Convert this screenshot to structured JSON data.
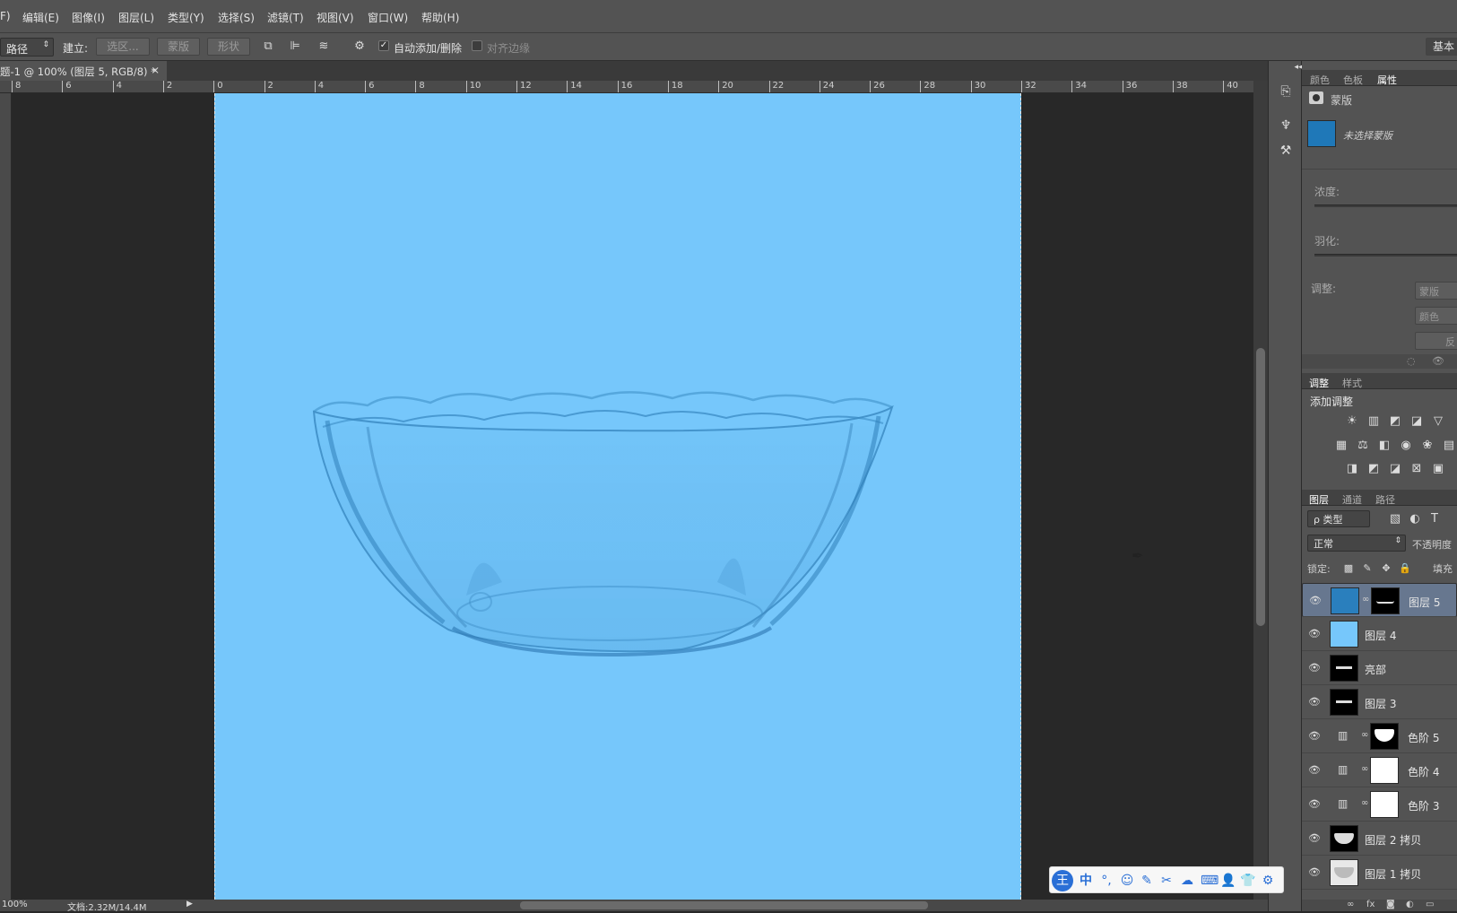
{
  "menu": [
    "F)",
    "编辑(E)",
    "图像(I)",
    "图层(L)",
    "类型(Y)",
    "选择(S)",
    "滤镜(T)",
    "视图(V)",
    "窗口(W)",
    "帮助(H)"
  ],
  "options_bar": {
    "mode_select": "路径",
    "create_label": "建立:",
    "selection_button": "选区...",
    "mask_button": "蒙版",
    "shape_button": "形状",
    "auto_add_delete_label": "自动添加/删除",
    "auto_add_delete_checked": true,
    "align_edges_label": "对齐边缘",
    "align_edges_checked": false,
    "workspace_button": "基本"
  },
  "document_tab": {
    "title": "题-1 @ 100% (图层 5, RGB/8) *",
    "close": "×"
  },
  "ruler_top": [
    "8",
    "6",
    "4",
    "2",
    "0",
    "2",
    "4",
    "6",
    "8",
    "10",
    "12",
    "14",
    "16",
    "18",
    "20",
    "22",
    "24",
    "26",
    "28",
    "30",
    "32",
    "34",
    "36",
    "38",
    "40"
  ],
  "canvas": {
    "background_color": "#76c7fb",
    "content": "glass bowl"
  },
  "status_bar": {
    "doc_info": "文档:2.32M/14.4M",
    "zoom": "100%"
  },
  "properties_panel": {
    "tabs": [
      "颜色",
      "色板",
      "属性"
    ],
    "active_tab": "属性",
    "type_label": "蒙版",
    "mask_status": "未选择蒙版",
    "density_label": "浓度:",
    "feather_label": "羽化:",
    "adjust_label": "调整:",
    "mask_edge_button": "蒙版",
    "color_range_button": "颜色",
    "invert_button": "反",
    "swatch_color": "#1f78b8"
  },
  "adjustments_panel": {
    "tabs": [
      "调整",
      "样式"
    ],
    "active_tab": "调整",
    "title": "添加调整",
    "icons_row1": [
      "brightness-icon",
      "levels-icon",
      "curves-icon",
      "exposure-icon",
      "vibrance-icon"
    ],
    "icons_row2": [
      "hue-saturation-icon",
      "color-balance-icon",
      "black-white-icon",
      "photo-filter-icon",
      "channel-mixer-icon",
      "color-lookup-icon"
    ],
    "icons_row3": [
      "invert-icon",
      "posterize-icon",
      "threshold-icon",
      "selective-color-icon",
      "gradient-map-icon"
    ]
  },
  "layers_panel": {
    "tabs": [
      "图层",
      "通道",
      "路径"
    ],
    "active_tab": "图层",
    "filter_select": "ρ 类型",
    "blend_mode": "正常",
    "opacity_label": "不透明度",
    "lock_label": "锁定:",
    "fill_label": "填充",
    "layers": [
      {
        "name": "图层 5",
        "thumb": "#2a7fbd",
        "mask": "black-rim",
        "selected": true
      },
      {
        "name": "图层 4",
        "thumb": "#76c7fb",
        "mask": null,
        "selected": false
      },
      {
        "name": "亮部",
        "thumb": "black-bowl",
        "mask": null,
        "selected": false
      },
      {
        "name": "图层 3",
        "thumb": "black-bowl",
        "mask": null,
        "selected": false
      },
      {
        "name": "色阶 5",
        "thumb": "levels-icon",
        "mask": "white-bowl",
        "selected": false
      },
      {
        "name": "色阶 4",
        "thumb": "levels-icon",
        "mask": "white",
        "selected": false
      },
      {
        "name": "色阶 3",
        "thumb": "levels-icon",
        "mask": "white",
        "selected": false
      },
      {
        "name": "图层 2 拷贝",
        "thumb": "black-bowl",
        "mask": null,
        "selected": false
      },
      {
        "name": "图层 1 拷贝",
        "thumb": "light-bowl",
        "mask": null,
        "selected": false
      }
    ]
  },
  "ime_toolbar": {
    "logo": "王",
    "lang": "中",
    "items": [
      "punctuation-icon",
      "emoji-icon",
      "pen-icon",
      "scissors-icon",
      "cloud-icon",
      "keyboard-icon",
      "user-icon",
      "shirt-icon",
      "settings-icon"
    ]
  }
}
